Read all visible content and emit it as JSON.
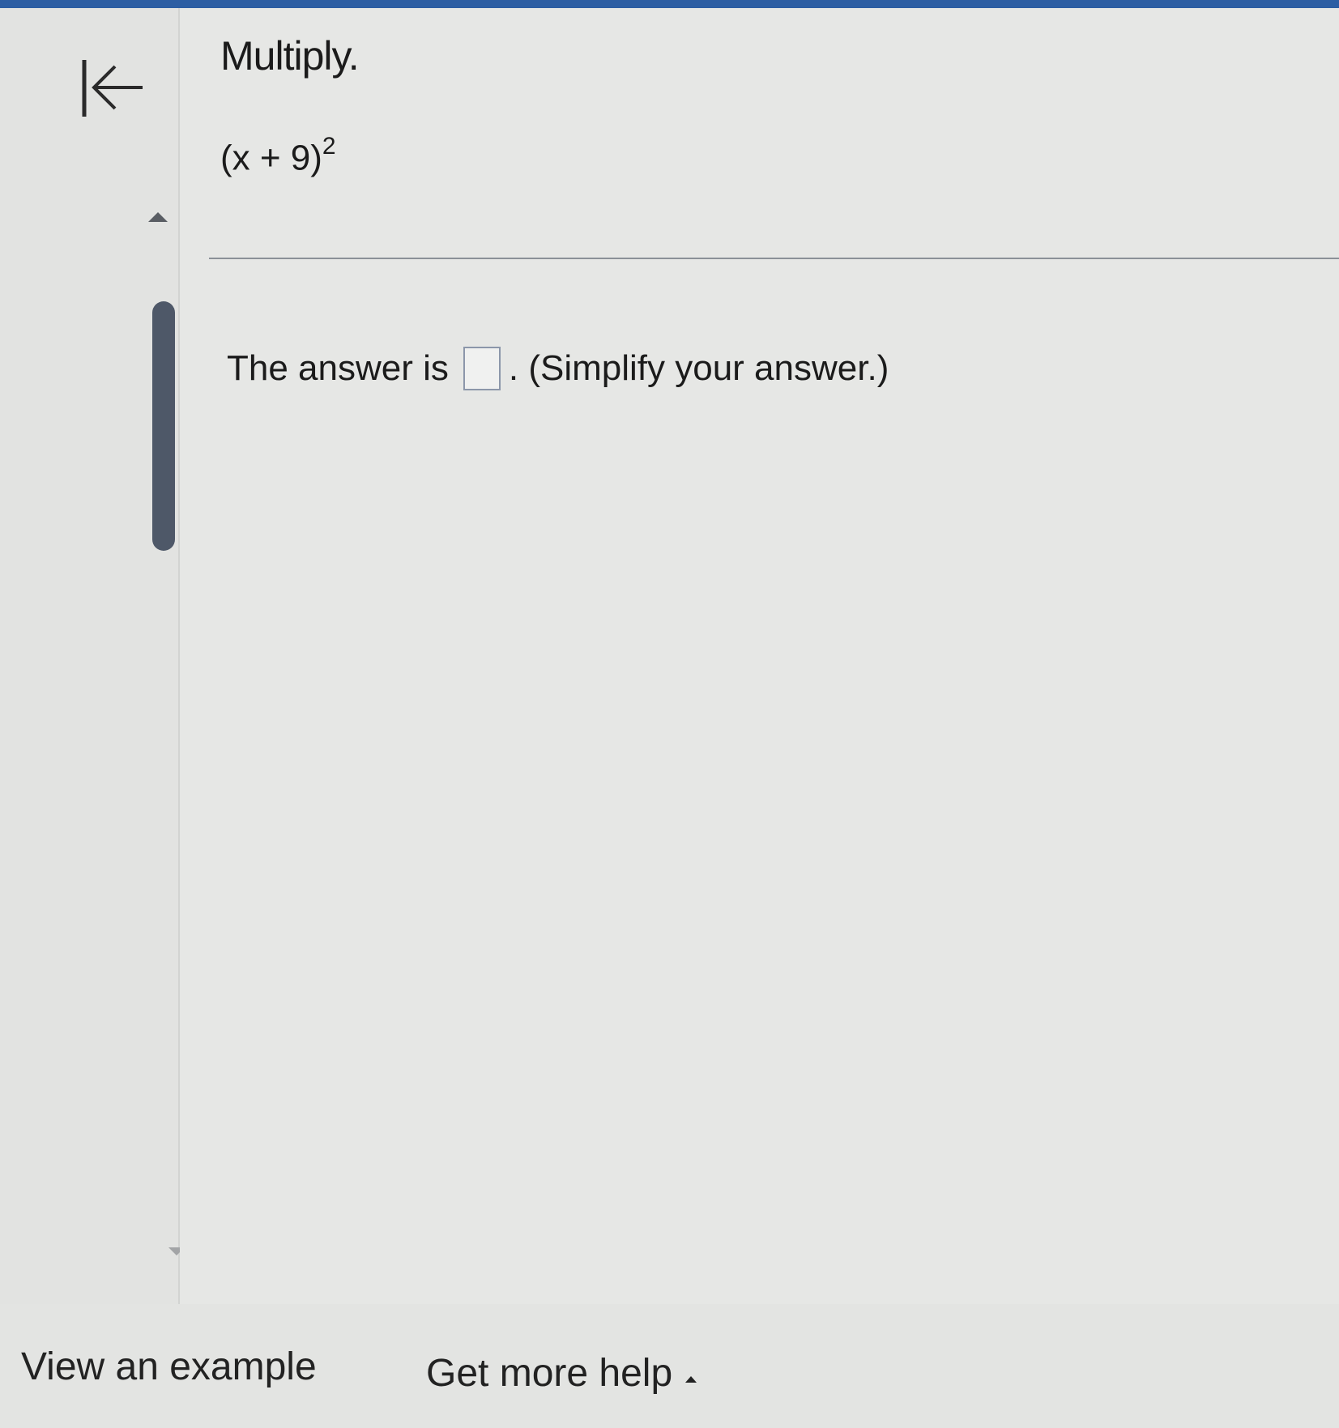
{
  "question": {
    "instruction": "Multiply.",
    "expression_base": "(x + 9)",
    "expression_exponent": "2",
    "answer_prefix": "The answer is",
    "answer_value": "",
    "answer_suffix": ". (Simplify your answer.)"
  },
  "footer": {
    "view_example": "View an example",
    "get_more_help": "Get more help"
  },
  "icons": {
    "back": "first-page-arrow-icon",
    "help_caret": "caret-up-icon"
  },
  "colors": {
    "accent_bar": "#2c5ea3",
    "scroll_thumb": "#4e5868"
  }
}
